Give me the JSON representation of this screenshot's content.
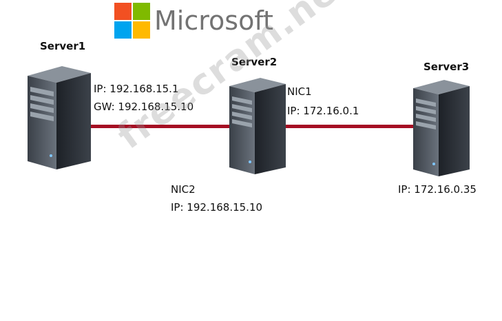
{
  "logo": {
    "text": "Microsoft",
    "colors": [
      "#f25022",
      "#7fba00",
      "#00a4ef",
      "#ffb900"
    ]
  },
  "servers": [
    {
      "name": "Server1",
      "labels": [
        "IP: 192.168.15.1",
        "GW: 192.168.15.10"
      ]
    },
    {
      "name": "Server2",
      "labels_nic1": [
        "NIC1",
        "IP: 172.16.0.1"
      ],
      "labels_nic2": [
        "NIC2",
        "IP: 192.168.15.10"
      ]
    },
    {
      "name": "Server3",
      "labels": [
        "IP: 172.16.0.35"
      ]
    }
  ],
  "link_color": "#a50d23",
  "watermark": "freecram.net"
}
